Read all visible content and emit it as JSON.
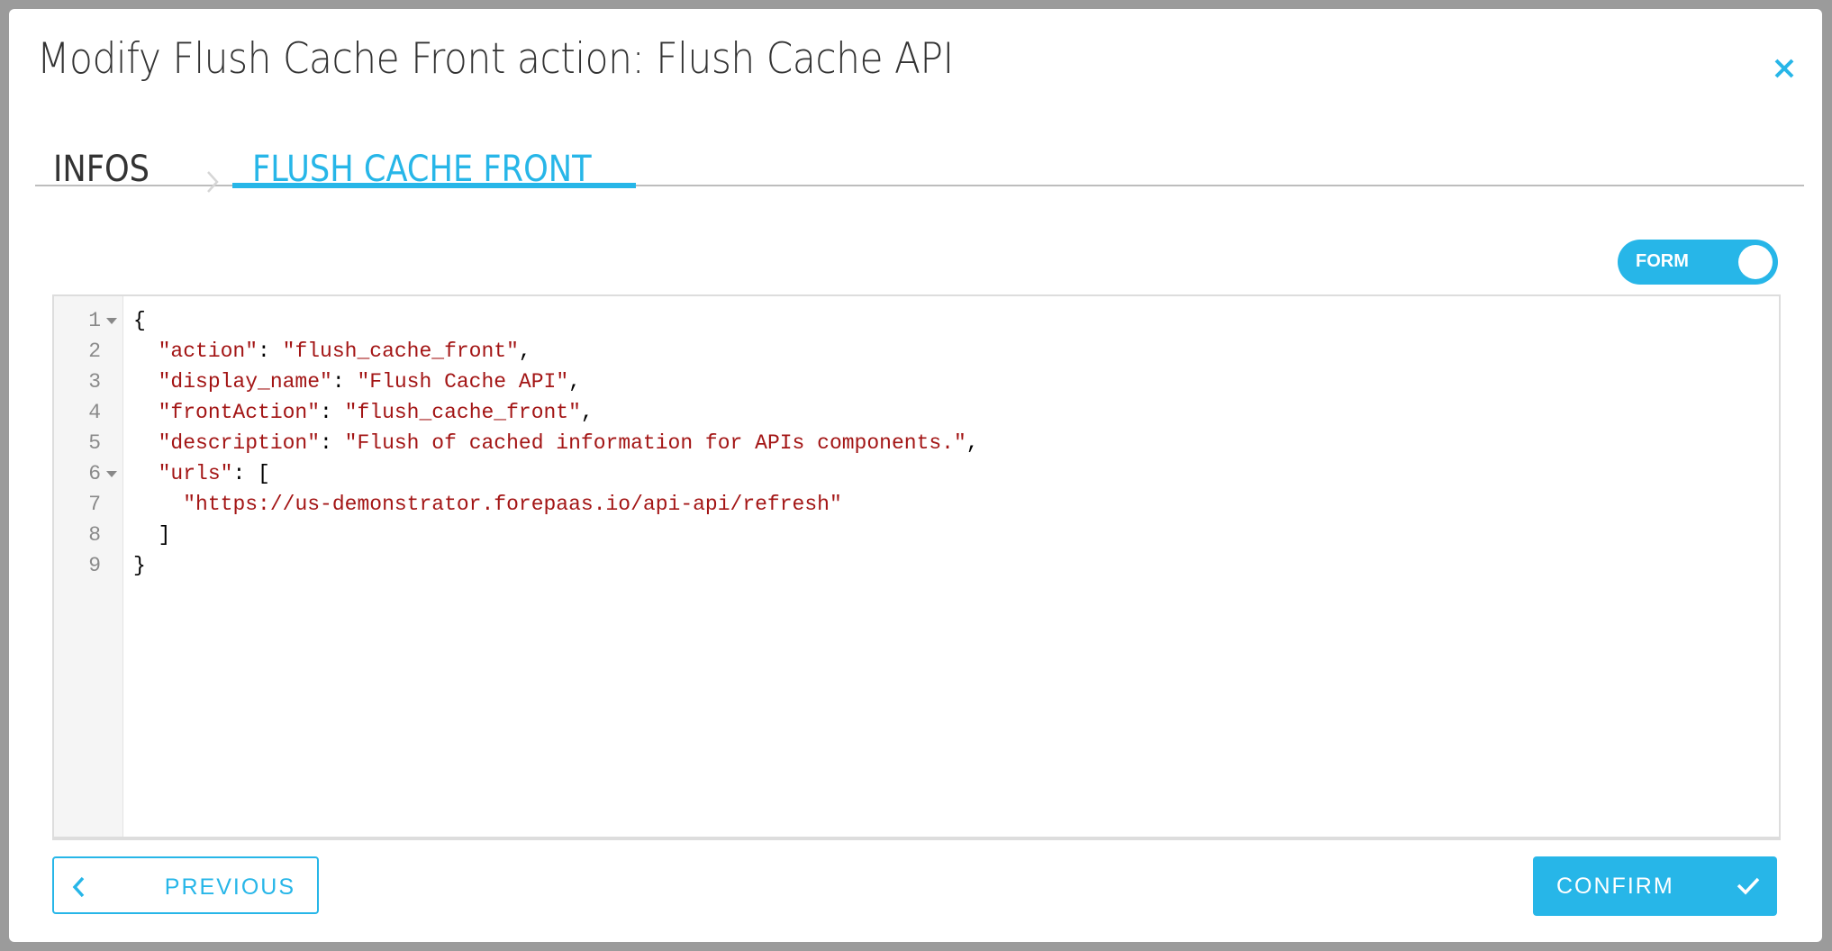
{
  "modal": {
    "title": "Modify Flush Cache Front action: Flush Cache API",
    "close_icon": "close-icon"
  },
  "tabs": [
    {
      "label": "INFOS",
      "active": false
    },
    {
      "label": "FLUSH CACHE FRONT",
      "active": true
    }
  ],
  "toggle": {
    "label": "FORM",
    "on": true
  },
  "editor": {
    "lines": [
      {
        "n": "1",
        "fold": true
      },
      {
        "n": "2",
        "fold": false
      },
      {
        "n": "3",
        "fold": false
      },
      {
        "n": "4",
        "fold": false
      },
      {
        "n": "5",
        "fold": false
      },
      {
        "n": "6",
        "fold": true
      },
      {
        "n": "7",
        "fold": false
      },
      {
        "n": "8",
        "fold": false
      },
      {
        "n": "9",
        "fold": false
      }
    ],
    "json": {
      "action": "flush_cache_front",
      "display_name": "Flush Cache API",
      "frontAction": "flush_cache_front",
      "description": "Flush of cached information for APIs components.",
      "url": "https://us-demonstrator.forepaas.io/api-api/refresh"
    },
    "keys": {
      "action": "\"action\"",
      "display_name": "\"display_name\"",
      "frontAction": "\"frontAction\"",
      "description": "\"description\"",
      "urls": "\"urls\""
    }
  },
  "footer": {
    "previous_label": "PREVIOUS",
    "confirm_label": "CONFIRM"
  },
  "colors": {
    "accent": "#27b6e8",
    "string": "#a31515",
    "overlay": "#9b9b9b"
  }
}
